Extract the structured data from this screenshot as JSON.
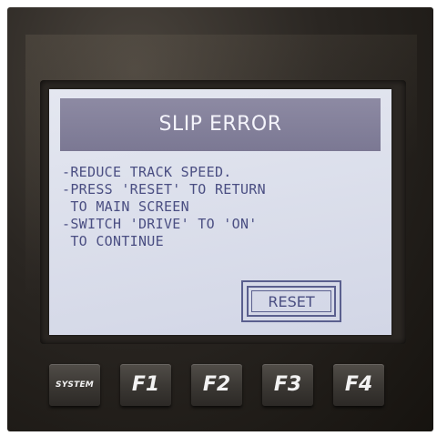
{
  "dialog": {
    "title": "SLIP ERROR",
    "message_lines": [
      "-REDUCE TRACK SPEED.",
      "-PRESS 'RESET' TO RETURN",
      " TO MAIN SCREEN",
      "-SWITCH 'DRIVE' TO 'ON'",
      " TO CONTINUE"
    ],
    "reset_label": "RESET"
  },
  "function_keys": [
    {
      "label": "SYSTEM"
    },
    {
      "label": "F1"
    },
    {
      "label": "F2"
    },
    {
      "label": "F3"
    },
    {
      "label": "F4"
    }
  ],
  "colors": {
    "title_bar": "#8d8aa3",
    "screen_background": "#dcdfeb",
    "text": "#4a4e82",
    "device_body": "#2a2622"
  }
}
